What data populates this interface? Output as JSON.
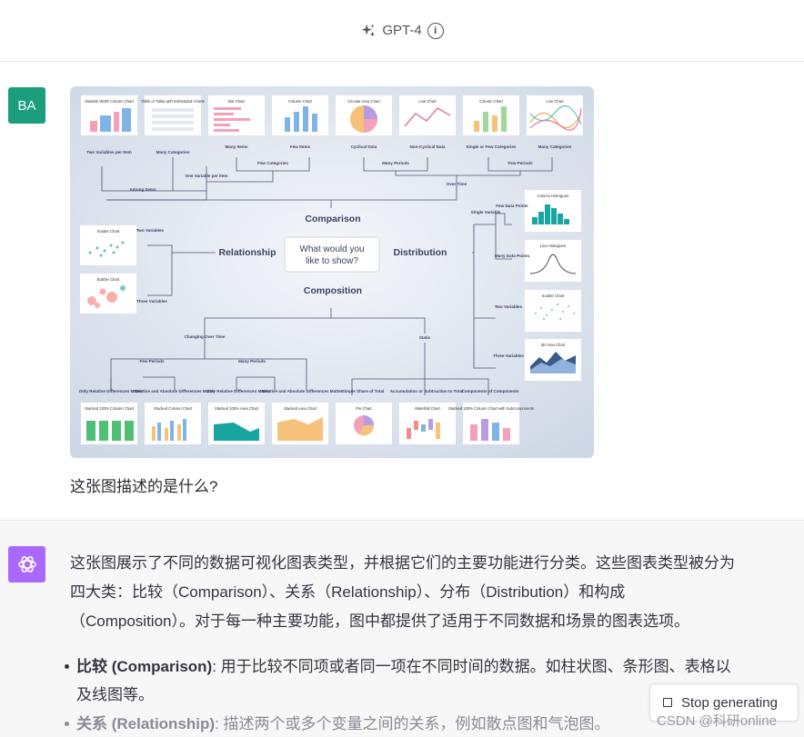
{
  "header": {
    "model_label": "GPT-4",
    "info_icon": "info-icon",
    "sparkle_icon": "sparkle-icon"
  },
  "user": {
    "avatar_initials": "BA",
    "question": "这张图描述的是什么?",
    "image": {
      "center_question": "What would you like to show?",
      "categories": {
        "comparison": "Comparison",
        "relationship": "Relationship",
        "distribution": "Distribution",
        "composition": "Composition"
      },
      "top_charts": [
        "Variable Width Column Chart",
        "Table or Table with Embedded Charts",
        "Bar Chart",
        "Column Chart",
        "Circular Area Chart",
        "Line Chart",
        "Column Chart",
        "Line Chart"
      ],
      "top_labels": [
        "Two Variables per Item",
        "Many Categories",
        "Many Items",
        "Few Items",
        "Cyclical Data",
        "Non-Cyclical Data",
        "Single or Few Categories",
        "Many Categories"
      ],
      "top_group_labels": [
        "One Variable per Item",
        "Few Categories",
        "Many Periods",
        "Few Periods",
        "Among Items",
        "Over Time"
      ],
      "left_charts": [
        "Scatter Chart",
        "Bubble Chart"
      ],
      "left_labels": [
        "Two Variables",
        "Three Variables"
      ],
      "right_charts": [
        "Column Histogram",
        "Line Histogram",
        "Scatter Chart",
        "3D Area Chart"
      ],
      "right_labels": [
        "Single Variable",
        "Few Data Points",
        "Many Data Points",
        "Two Variables",
        "Three Variables"
      ],
      "bottom_charts": [
        "Stacked 100% Column Chart",
        "Stacked Column Chart",
        "Stacked 100% Area Chart",
        "Stacked Area Chart",
        "Pie Chart",
        "Waterfall Chart",
        "Stacked 100% Column Chart with Subcomponents"
      ],
      "bottom_labels": [
        "Only Relative Differences Matter",
        "Relative and Absolute Differences Matter",
        "Only Relative Differences Matter",
        "Relative and Absolute Differences Matter",
        "Simple Share of Total",
        "Accumulation or Subtraction to Total",
        "Components of Components"
      ],
      "bottom_group_labels": [
        "Changing Over Time",
        "Static",
        "Few Periods",
        "Many Periods"
      ]
    }
  },
  "assistant": {
    "avatar_icon": "openai-logo-icon",
    "paragraph": "这张图展示了不同的数据可视化图表类型，并根据它们的主要功能进行分类。这些图表类型被分为四大类：比较（Comparison）、关系（Relationship）、分布（Distribution）和构成（Composition）。对于每一种主要功能，图中都提供了适用于不同数据和场景的图表选项。",
    "bullets": [
      {
        "term": "比较 (Comparison)",
        "text": ": 用于比较不同项或者同一项在不同时间的数据。如柱状图、条形图、表格以及线图等。"
      },
      {
        "term": "关系 (Relationship)",
        "text": ": 描述两个或多个变量之间的关系，例如散点图和气泡图。"
      }
    ]
  },
  "controls": {
    "stop_label": "Stop generating"
  },
  "watermark": "CSDN @科研online",
  "colors": {
    "user_avatar": "#1a9e7e",
    "assistant_avatar": "#ab68ff",
    "assistant_bg": "#f7f7f8"
  }
}
